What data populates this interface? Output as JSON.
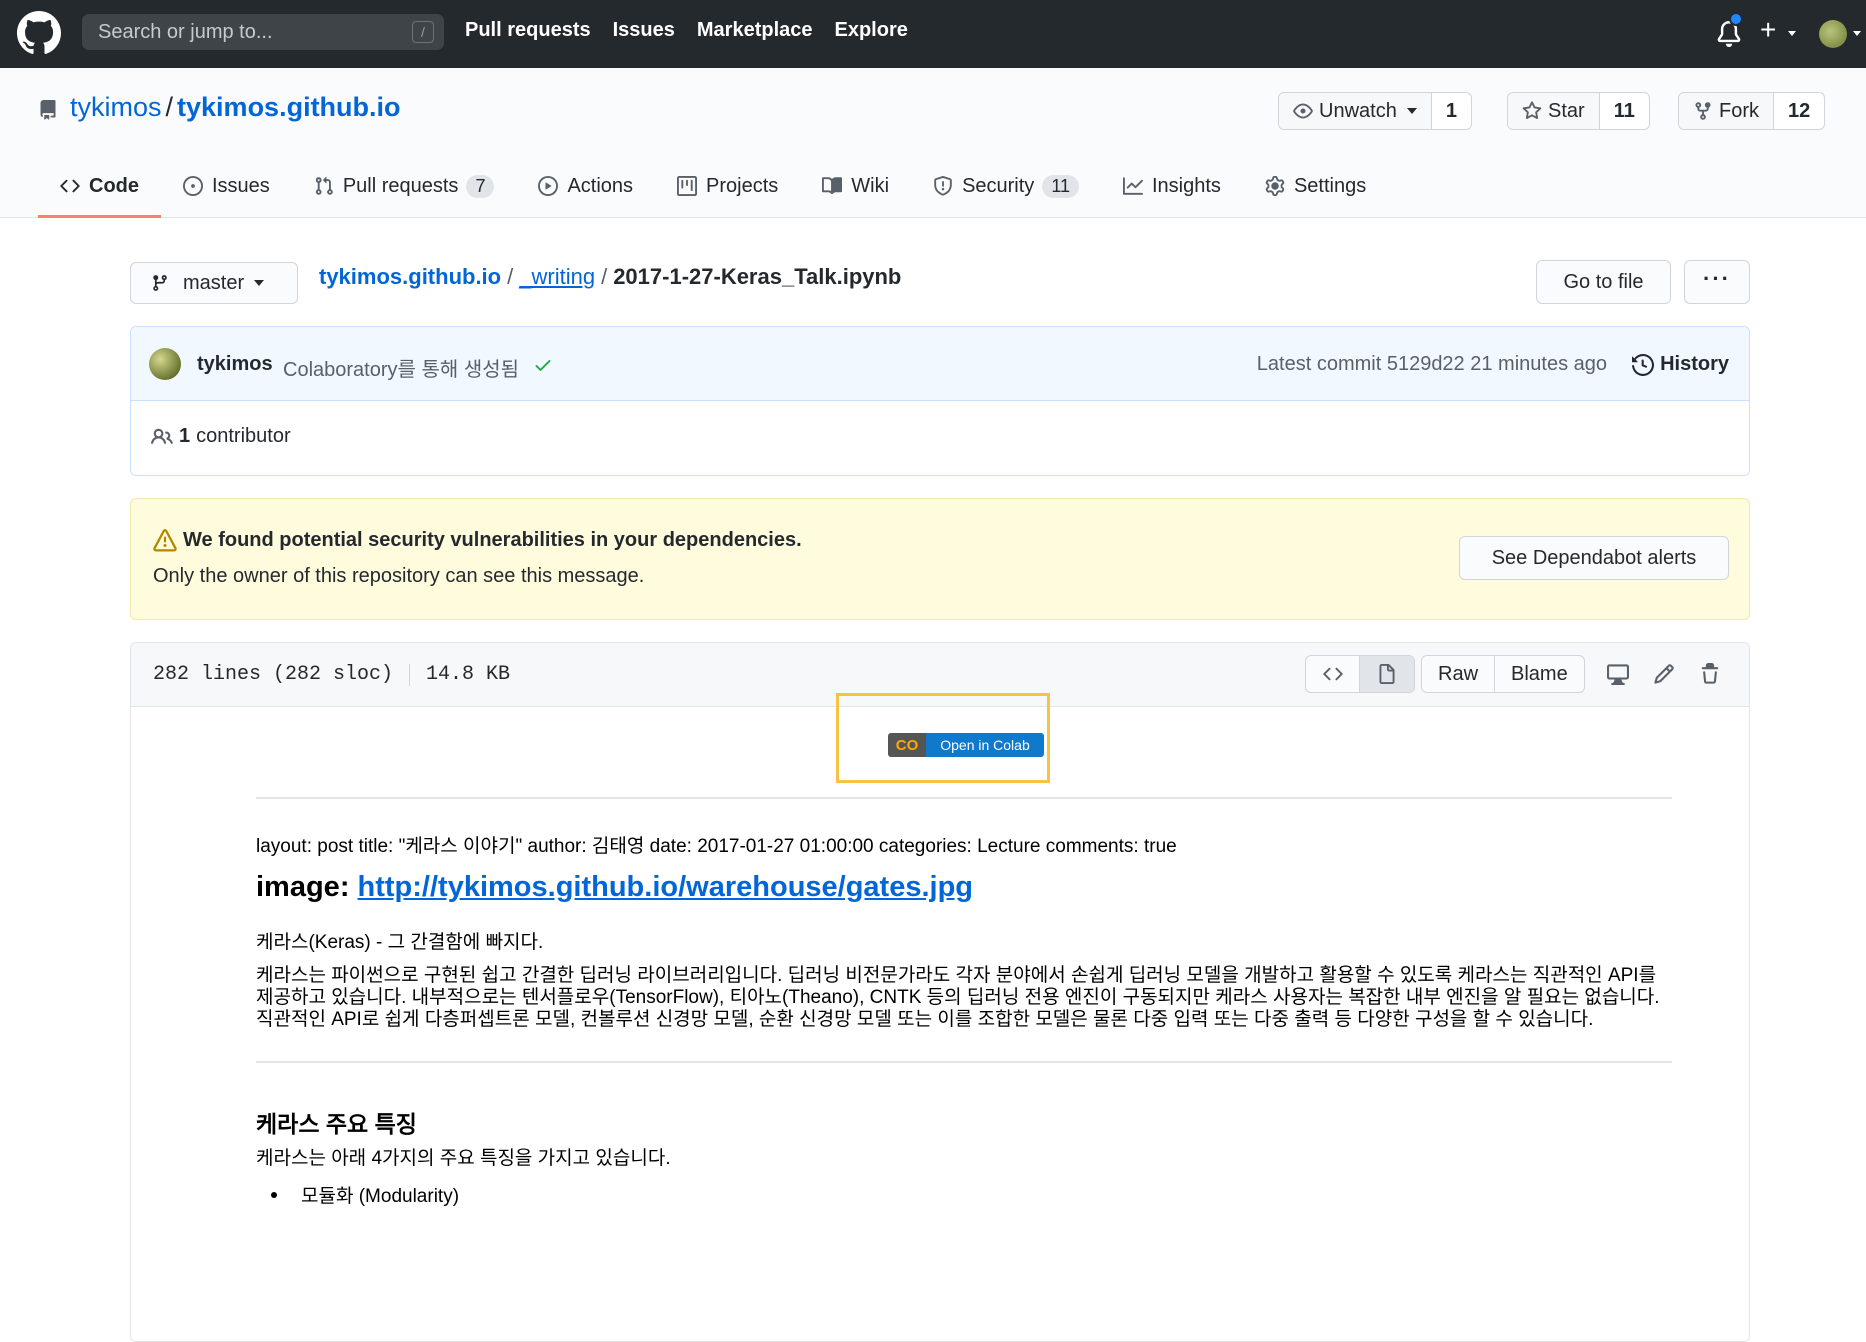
{
  "header": {
    "search_placeholder": "Search or jump to...",
    "search_key": "/",
    "nav": [
      "Pull requests",
      "Issues",
      "Marketplace",
      "Explore"
    ],
    "plus": "+"
  },
  "repo": {
    "owner": "tykimos",
    "separator": "/",
    "name": "tykimos.github.io",
    "unwatch_label": "Unwatch",
    "watch_count": "1",
    "star_label": "Star",
    "star_count": "11",
    "fork_label": "Fork",
    "fork_count": "12"
  },
  "tabs": [
    {
      "label": "Code",
      "icon": "code-icon"
    },
    {
      "label": "Issues",
      "icon": "issue-icon"
    },
    {
      "label": "Pull requests",
      "icon": "pull-request-icon",
      "badge": "7"
    },
    {
      "label": "Actions",
      "icon": "play-icon"
    },
    {
      "label": "Projects",
      "icon": "project-icon"
    },
    {
      "label": "Wiki",
      "icon": "book-icon"
    },
    {
      "label": "Security",
      "icon": "shield-icon",
      "badge": "11"
    },
    {
      "label": "Insights",
      "icon": "graph-icon"
    },
    {
      "label": "Settings",
      "icon": "gear-icon"
    }
  ],
  "filenav": {
    "branch": "master",
    "crumb_root": "tykimos.github.io",
    "crumb_dir": "_writing",
    "crumb_file": "2017-1-27-Keras_Talk.ipynb",
    "sep": "/",
    "goto_label": "Go to file",
    "more_label": "···"
  },
  "commit": {
    "author": "tykimos",
    "message": "Colaboratory를 통해 생성됨",
    "meta": "Latest commit 5129d22 21 minutes ago",
    "history_label": "History",
    "contributor_count": "1",
    "contributor_label": "contributor"
  },
  "alert": {
    "title": "We found potential security vulnerabilities in your dependencies.",
    "subtitle": "Only the owner of this repository can see this message.",
    "button": "See Dependabot alerts"
  },
  "file": {
    "lines": "282 lines (282 sloc)",
    "size": "14.8 KB",
    "raw_label": "Raw",
    "blame_label": "Blame"
  },
  "content": {
    "colab_logo": "CO",
    "colab_text": "Open in Colab",
    "meta_line": "layout: post title: \"케라스 이야기\" author: 김태영 date: 2017-01-27 01:00:00 categories: Lecture comments: true",
    "image_prefix": "image: ",
    "image_link": "http://tykimos.github.io/warehouse/gates.jpg",
    "intro": "케라스(Keras) - 그 간결함에 빠지다.",
    "paragraph": "케라스는 파이썬으로 구현된 쉽고 간결한 딥러닝 라이브러리입니다. 딥러닝 비전문가라도 각자 분야에서 손쉽게 딥러닝 모델을 개발하고 활용할 수 있도록 케라스는 직관적인 API를 제공하고 있습니다. 내부적으로는 텐서플로우(TensorFlow), 티아노(Theano), CNTK 등의 딥러닝 전용 엔진이 구동되지만 케라스 사용자는 복잡한 내부 엔진을 알 필요는 없습니다. 직관적인 API로 쉽게 다층퍼셉트론 모델, 컨볼루션 신경망 모델, 순환 신경망 모델 또는 이를 조합한 모델은 물론 다중 입력 또는 다중 출력 등 다양한 구성을 할 수 있습니다.",
    "heading": "케라스 주요 특징",
    "features_intro": "케라스는 아래 4가지의 주요 특징을 가지고 있습니다.",
    "list_item": "모듈화 (Modularity)"
  },
  "colors": {
    "header_bg": "#24292e",
    "link": "#0366d6",
    "active_tab": "#f9826c",
    "colab_orange": "#f9ab00",
    "colab_blue": "#0f7acc",
    "highlight_frame": "#f6c343"
  }
}
